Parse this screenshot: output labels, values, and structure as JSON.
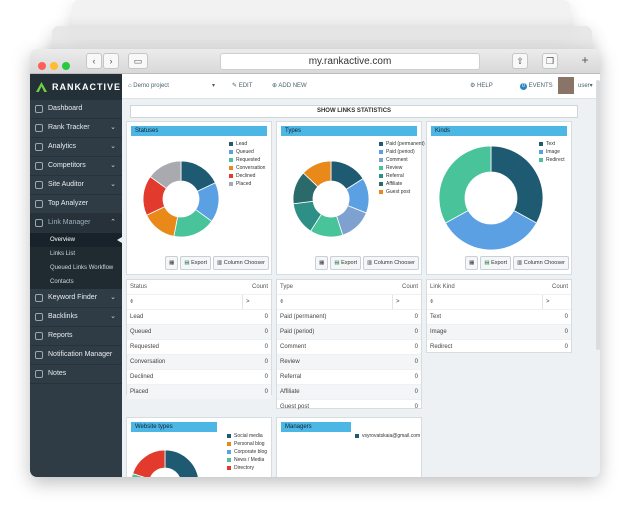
{
  "browser": {
    "url": "my.rankactive.com"
  },
  "app": {
    "logo_text": "RANKACTIVE",
    "project": "Demo project",
    "toolbar": {
      "edit": "EDIT",
      "add_new": "ADD NEW",
      "help": "HELP",
      "events": "EVENTS",
      "events_count": "0",
      "user": "user"
    },
    "nav": [
      {
        "label": "Dashboard"
      },
      {
        "label": "Rank Tracker"
      },
      {
        "label": "Analytics"
      },
      {
        "label": "Competitors"
      },
      {
        "label": "Site Auditor"
      },
      {
        "label": "Top Analyzer"
      },
      {
        "label": "Link Manager"
      },
      {
        "label": "Keyword Finder"
      },
      {
        "label": "Backlinks"
      },
      {
        "label": "Reports"
      },
      {
        "label": "Notification Manager"
      },
      {
        "label": "Notes"
      }
    ],
    "subnav": [
      {
        "label": "Overview"
      },
      {
        "label": "Links List"
      },
      {
        "label": "Queued Links Workflow"
      },
      {
        "label": "Contacts"
      }
    ]
  },
  "page": {
    "title": "SHOW LINKS STATISTICS",
    "buttons": {
      "export": "Export",
      "chooser": "Column Chooser"
    },
    "panels": [
      {
        "title": "Statuses",
        "legend": [
          {
            "label": "Lead",
            "color": "#1f5a73"
          },
          {
            "label": "Queued",
            "color": "#5aa0e3"
          },
          {
            "label": "Requested",
            "color": "#48c39a"
          },
          {
            "label": "Conversation",
            "color": "#e8891a"
          },
          {
            "label": "Declined",
            "color": "#e23b2e"
          },
          {
            "label": "Placed",
            "color": "#a9a9b0"
          }
        ],
        "slices": [
          18,
          17,
          18,
          15,
          17,
          15
        ],
        "col1": "Status",
        "col2": "Count",
        "rows": [
          {
            "name": "Lead",
            "count": "0"
          },
          {
            "name": "Queued",
            "count": "0"
          },
          {
            "name": "Requested",
            "count": "0"
          },
          {
            "name": "Conversation",
            "count": "0"
          },
          {
            "name": "Declined",
            "count": "0"
          },
          {
            "name": "Placed",
            "count": "0"
          }
        ]
      },
      {
        "title": "Types",
        "legend": [
          {
            "label": "Paid (permanent)",
            "color": "#1f5a73"
          },
          {
            "label": "Paid (period)",
            "color": "#5aa0e3"
          },
          {
            "label": "Comment",
            "color": "#7ea1cf"
          },
          {
            "label": "Review",
            "color": "#48c39a"
          },
          {
            "label": "Referral",
            "color": "#2e8f86"
          },
          {
            "label": "Affiliate",
            "color": "#2a6a6a"
          },
          {
            "label": "Guest post",
            "color": "#e8891a"
          }
        ],
        "slices": [
          16,
          15,
          14,
          14,
          14,
          14,
          13
        ],
        "col1": "Type",
        "col2": "Count",
        "rows": [
          {
            "name": "Paid (permanent)",
            "count": "0"
          },
          {
            "name": "Paid (period)",
            "count": "0"
          },
          {
            "name": "Comment",
            "count": "0"
          },
          {
            "name": "Review",
            "count": "0"
          },
          {
            "name": "Referral",
            "count": "0"
          },
          {
            "name": "Affiliate",
            "count": "0"
          },
          {
            "name": "Guest post",
            "count": "0"
          }
        ]
      },
      {
        "title": "Kinds",
        "legend": [
          {
            "label": "Text",
            "color": "#1f5a73"
          },
          {
            "label": "Image",
            "color": "#5aa0e3"
          },
          {
            "label": "Redirect",
            "color": "#48c39a"
          }
        ],
        "slices": [
          33,
          34,
          33
        ],
        "col1": "Link Kind",
        "col2": "Count",
        "rows": [
          {
            "name": "Text",
            "count": "0"
          },
          {
            "name": "Image",
            "count": "0"
          },
          {
            "name": "Redirect",
            "count": "0"
          }
        ]
      }
    ],
    "bottom_panels": [
      {
        "title": "Website types",
        "legend": [
          {
            "label": "Social media",
            "color": "#1f5a73"
          },
          {
            "label": "Personal blog",
            "color": "#e8891a"
          },
          {
            "label": "Corporate blog",
            "color": "#5aa0e3"
          },
          {
            "label": "News / Media",
            "color": "#48c39a"
          },
          {
            "label": "Directory",
            "color": "#e23b2e"
          }
        ]
      },
      {
        "title": "Managers",
        "legend": [
          {
            "label": "vsyrovatskaia@gmail.com",
            "color": "#1f5a73"
          }
        ]
      }
    ]
  }
}
